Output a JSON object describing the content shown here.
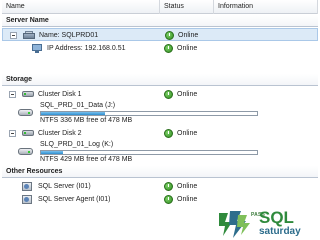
{
  "columns": {
    "name": "Name",
    "status": "Status",
    "information": "Information"
  },
  "groups": {
    "server_name": "Server Name",
    "storage": "Storage",
    "other_resources": "Other Resources"
  },
  "server": {
    "name_label": "Name: SQLPRD01",
    "ip_label": "IP Address: 192.168.0.51",
    "status": "Online",
    "ip_status": "Online"
  },
  "disks": [
    {
      "name": "Cluster Disk 1",
      "status": "Online",
      "volume": "SQL_PRD_01_Data (J:)",
      "free_text": "NTFS 336 MB free of 478 MB",
      "used_fraction": 0.297
    },
    {
      "name": "Cluster Disk 2",
      "status": "Online",
      "volume": "SLQ_PRD_01_Log (K:)",
      "free_text": "NTFS 429 MB free of 478 MB",
      "used_fraction": 0.103
    }
  ],
  "resources": [
    {
      "name": "SQL Server (I01)",
      "status": "Online"
    },
    {
      "name": "SQL Server Agent (I01)",
      "status": "Online"
    }
  ],
  "logo": {
    "pass": "PASS",
    "sql": "SQL",
    "saturday": "saturday"
  },
  "colors": {
    "online": "#2f8c1f",
    "selection": "#dceaf7",
    "progress": "#2f8fd0"
  },
  "icons": [
    "server-icon",
    "network-icon",
    "cluster-disk-icon",
    "volume-disk-icon",
    "service-icon",
    "online-status-icon"
  ]
}
